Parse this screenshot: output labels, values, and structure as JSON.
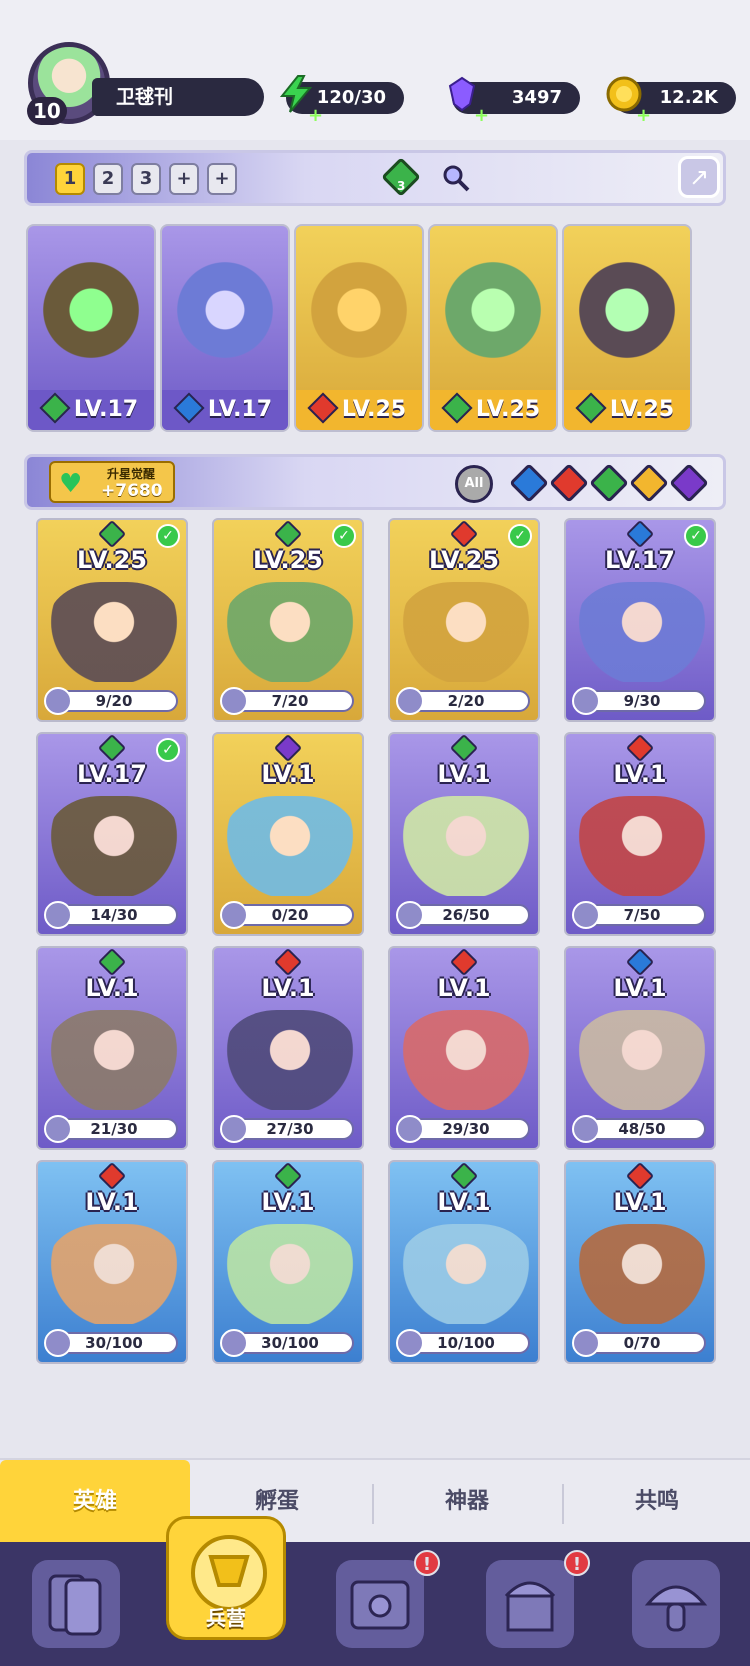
{
  "player": {
    "name": "卫毬刊",
    "level": "10"
  },
  "resources": [
    {
      "name": "energy",
      "value": "120/30",
      "icon": "lightning-icon",
      "color": "#3ad34f"
    },
    {
      "name": "gem",
      "value": "3497",
      "icon": "gem-icon",
      "color": "#8b5cff"
    },
    {
      "name": "gold",
      "value": "12.2K",
      "icon": "coin-icon",
      "color": "#f2c01a"
    }
  ],
  "team_slots": [
    "1",
    "2",
    "3",
    "+",
    "+"
  ],
  "team_tools": {
    "gem_count": "3"
  },
  "team": [
    {
      "level": "LV.17",
      "element": "wind",
      "elementColor": "#3bb34a",
      "bg": "purple"
    },
    {
      "level": "LV.17",
      "element": "water",
      "elementColor": "#2a7ad9",
      "bg": "purple"
    },
    {
      "level": "LV.25",
      "element": "fire",
      "elementColor": "#e03a2d",
      "bg": "gold"
    },
    {
      "level": "LV.25",
      "element": "wind",
      "elementColor": "#3bb34a",
      "bg": "gold"
    },
    {
      "level": "LV.25",
      "element": "wind",
      "elementColor": "#3bb34a",
      "bg": "gold"
    }
  ],
  "awaken": {
    "title": "升星觉醒",
    "value": "+7680"
  },
  "element_filters": [
    {
      "name": "all",
      "label": "All",
      "color": "#9a9a9a"
    },
    {
      "name": "water",
      "color": "#2a7ad9"
    },
    {
      "name": "fire",
      "color": "#e03a2d"
    },
    {
      "name": "wind",
      "color": "#3bb34a"
    },
    {
      "name": "light",
      "color": "#f2b62e"
    },
    {
      "name": "dark",
      "color": "#7a3ac9"
    }
  ],
  "heroes": [
    {
      "level": "LV.25",
      "progress": "9/20",
      "element": "wind",
      "elementColor": "#3bb34a",
      "bg": "gold",
      "checked": true,
      "figure": "#5a4b55"
    },
    {
      "level": "LV.25",
      "progress": "7/20",
      "element": "wind",
      "elementColor": "#3bb34a",
      "bg": "gold",
      "checked": true,
      "figure": "#6da86a"
    },
    {
      "level": "LV.25",
      "progress": "2/20",
      "element": "fire",
      "elementColor": "#e03a2d",
      "bg": "gold",
      "checked": true,
      "figure": "#d2a33e"
    },
    {
      "level": "LV.17",
      "progress": "9/30",
      "element": "water",
      "elementColor": "#2a7ad9",
      "bg": "purple",
      "checked": true,
      "figure": "#6d7bd6"
    },
    {
      "level": "LV.17",
      "progress": "14/30",
      "element": "wind",
      "elementColor": "#3bb34a",
      "bg": "purple",
      "checked": true,
      "figure": "#6a5a3a"
    },
    {
      "level": "LV.1",
      "progress": "0/20",
      "element": "dark",
      "elementColor": "#7a3ac9",
      "bg": "gold",
      "checked": false,
      "figure": "#6fbbe6"
    },
    {
      "level": "LV.1",
      "progress": "26/50",
      "element": "wind",
      "elementColor": "#3bb34a",
      "bg": "purple",
      "checked": false,
      "figure": "#cfe7a6"
    },
    {
      "level": "LV.1",
      "progress": "7/50",
      "element": "fire",
      "elementColor": "#e03a2d",
      "bg": "purple",
      "checked": false,
      "figure": "#c24545"
    },
    {
      "level": "LV.1",
      "progress": "21/30",
      "element": "wind",
      "elementColor": "#3bb34a",
      "bg": "purple",
      "checked": false,
      "figure": "#8b7a6a"
    },
    {
      "level": "LV.1",
      "progress": "27/30",
      "element": "fire",
      "elementColor": "#e03a2d",
      "bg": "purple",
      "checked": false,
      "figure": "#4f4a7a"
    },
    {
      "level": "LV.1",
      "progress": "29/30",
      "element": "fire",
      "elementColor": "#e03a2d",
      "bg": "purple",
      "checked": false,
      "figure": "#d86a6a"
    },
    {
      "level": "LV.1",
      "progress": "48/50",
      "element": "water",
      "elementColor": "#2a7ad9",
      "bg": "purple",
      "checked": false,
      "figure": "#c9b9a3"
    },
    {
      "level": "LV.1",
      "progress": "30/100",
      "element": "fire",
      "elementColor": "#e03a2d",
      "bg": "blue",
      "checked": false,
      "figure": "#e2a36c"
    },
    {
      "level": "LV.1",
      "progress": "30/100",
      "element": "wind",
      "elementColor": "#3bb34a",
      "bg": "blue",
      "checked": false,
      "figure": "#b9e3a5"
    },
    {
      "level": "LV.1",
      "progress": "10/100",
      "element": "wind",
      "elementColor": "#3bb34a",
      "bg": "blue",
      "checked": false,
      "figure": "#9bcbe6"
    },
    {
      "level": "LV.1",
      "progress": "0/70",
      "element": "fire",
      "elementColor": "#e03a2d",
      "bg": "blue",
      "checked": false,
      "figure": "#b46a3f"
    }
  ],
  "subtabs": [
    "英雄",
    "孵蛋",
    "神器",
    "共鸣"
  ],
  "nav": {
    "active_label": "兵营",
    "badges": [
      {
        "name": "book-badge",
        "text": "!"
      },
      {
        "name": "temple-badge",
        "text": "!"
      }
    ]
  }
}
